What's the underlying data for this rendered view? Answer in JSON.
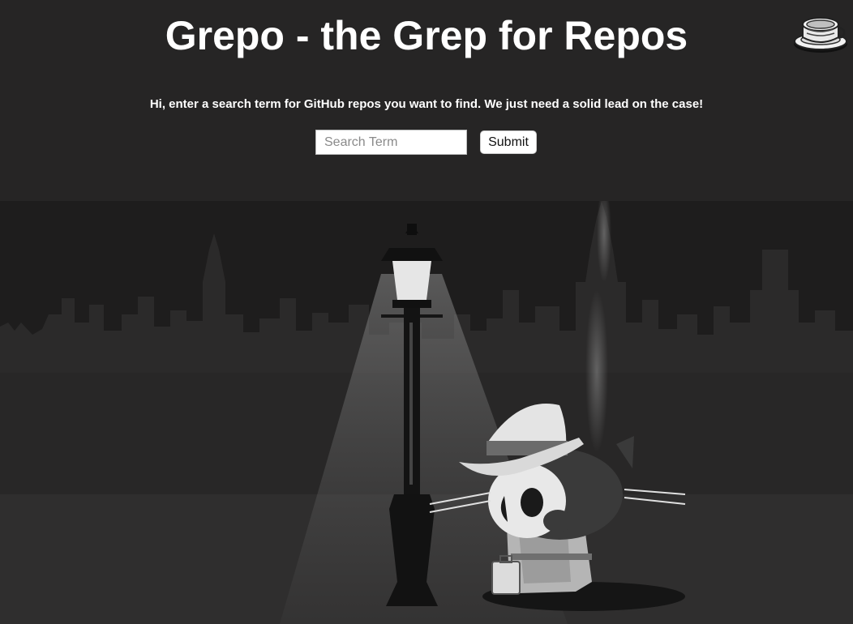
{
  "header": {
    "title": "Grepo - the Grep for Repos",
    "intro": "Hi, enter a search term for GitHub repos you want to find. We just need a solid lead on the case!"
  },
  "search": {
    "placeholder": "Search Term",
    "value": "",
    "submit_label": "Submit"
  },
  "logo": {
    "icon": "coffee-cup-icon"
  },
  "illustration": {
    "icon": "detective-octocat-illustration"
  },
  "colors": {
    "background": "#262525",
    "scene_sky": "#1e1d1d",
    "skyline": "#2b2a2a",
    "ground": "#2f2e2e",
    "text": "#ffffff"
  }
}
